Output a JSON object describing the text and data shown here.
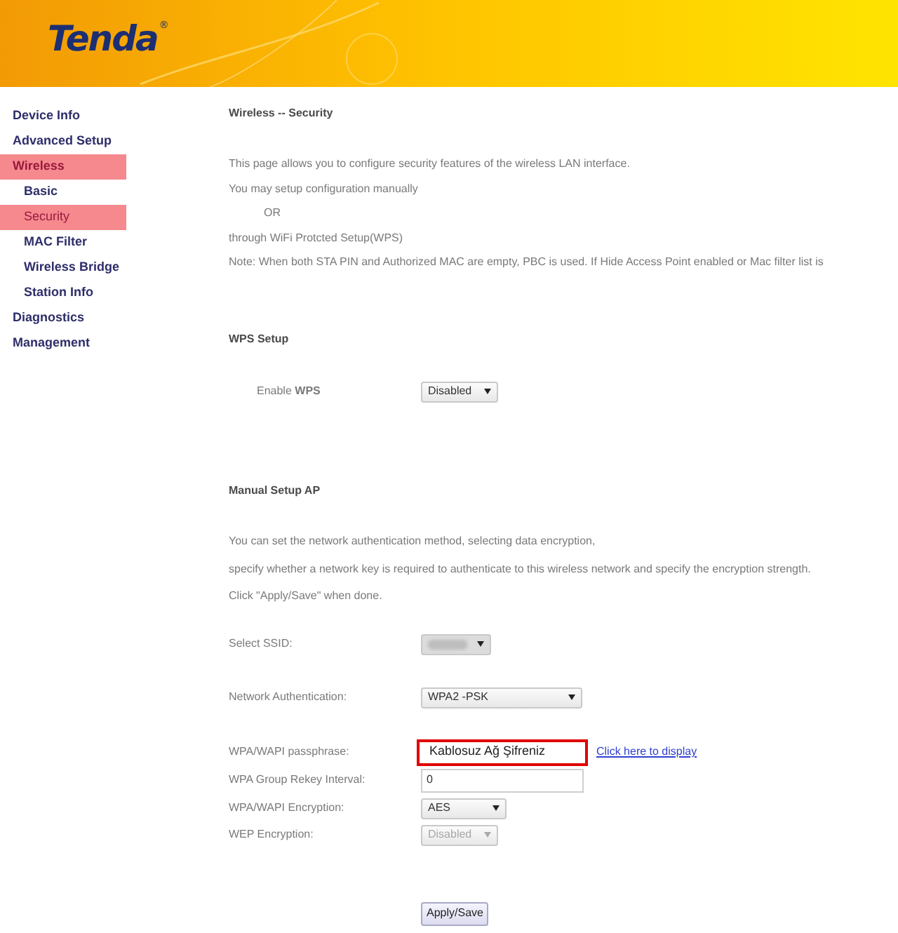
{
  "header": {
    "logo": "Tenda",
    "logo_mark": "®"
  },
  "sidebar": {
    "items": [
      {
        "label": "Device Info",
        "selected": false
      },
      {
        "label": "Advanced Setup",
        "selected": false
      },
      {
        "label": "Wireless",
        "selected": true,
        "children": [
          {
            "label": "Basic",
            "selected": false
          },
          {
            "label": "Security",
            "selected": true
          },
          {
            "label": "MAC Filter",
            "selected": false
          },
          {
            "label": "Wireless Bridge",
            "selected": false
          },
          {
            "label": "Station Info",
            "selected": false
          }
        ]
      },
      {
        "label": "Diagnostics",
        "selected": false
      },
      {
        "label": "Management",
        "selected": false
      }
    ]
  },
  "page_title": "Wireless -- Security",
  "intro_before": [
    "This page allows you to configure security features of the wireless LAN interface.",
    "You may setup configuration manually"
  ],
  "or": "OR",
  "intro_after": [
    "through WiFi Protcted Setup(WPS)",
    "Note: When both STA PIN and Authorized MAC are empty, PBC is used. If Hide Access Point enabled or Mac filter list is"
  ],
  "wps": {
    "heading": "WPS Setup",
    "label": "Enable **WPS**",
    "value": "Disabled"
  },
  "manual_setup": {
    "heading": "Manual Setup AP",
    "description": [
      "You can set the network authentication method, selecting data encryption,",
      "specify whether a network key is required to authenticate to this wireless network and specify the encryption strength.",
      "Click \"Apply/Save\" when done."
    ],
    "fields": [
      {
        "kind": "select",
        "label": "Select SSID:",
        "redacted": true,
        "disabled": false
      },
      {
        "kind": "select",
        "label": "Network Authentication:",
        "value": "WPA2 -PSK",
        "redacted": false,
        "disabled": false
      },
      {
        "kind": "input",
        "label": "WPA/WAPI passphrase:",
        "value": "Kablosuz Ağ Şifreniz",
        "highlighted": true,
        "link": "Click here to display"
      },
      {
        "kind": "input",
        "label": "WPA Group Rekey Interval:",
        "value": "0",
        "highlighted": false
      },
      {
        "kind": "select",
        "label": "WPA/WAPI Encryption:",
        "value": "AES",
        "redacted": false,
        "disabled": false
      },
      {
        "kind": "select",
        "label": "WEP Encryption:",
        "value": "Disabled",
        "redacted": false,
        "disabled": true
      }
    ],
    "apply_button": "Apply/Save"
  }
}
